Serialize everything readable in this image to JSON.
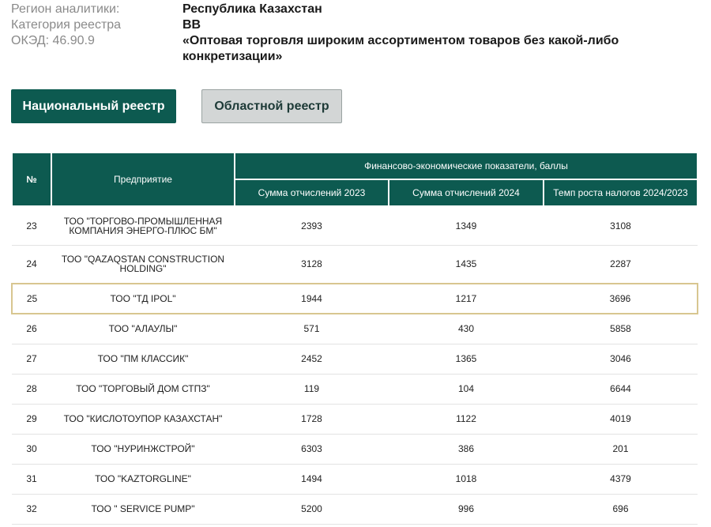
{
  "meta": {
    "region_label": "Регион аналитики:",
    "region_value": "Республика Казахстан",
    "category_label": "Категория реестра",
    "category_value": "BB",
    "okved_label": "ОКЭД: 46.90.9",
    "okved_value": "«Оптовая торговля широким ассортиментом товаров без какой-либо конкретизации»"
  },
  "buttons": {
    "national": "Национальный реестр",
    "regional": "Областной реестр"
  },
  "table": {
    "headers": {
      "num": "№",
      "enterprise": "Предприятие",
      "group": "Финансово-экономические показатели, баллы",
      "col2023": "Сумма отчислений 2023",
      "col2024": "Сумма отчислений 2024",
      "growth": "Темп роста налогов 2024/2023"
    },
    "rows": [
      {
        "num": "23",
        "name": "ТОО \"ТОРГОВО-ПРОМЫШЛЕННАЯ КОМПАНИЯ ЭНЕРГО-ПЛЮС БМ\"",
        "s2023": "2393",
        "s2024": "1349",
        "growth": "3108"
      },
      {
        "num": "24",
        "name": "ТОО \"QAZAQSTAN CONSTRUCTION HOLDING\"",
        "s2023": "3128",
        "s2024": "1435",
        "growth": "2287"
      },
      {
        "num": "25",
        "name": "ТОО \"ТД IPOL\"",
        "s2023": "1944",
        "s2024": "1217",
        "growth": "3696"
      },
      {
        "num": "26",
        "name": "ТОО \"АЛАУЛЫ\"",
        "s2023": "571",
        "s2024": "430",
        "growth": "5858"
      },
      {
        "num": "27",
        "name": "ТОО \"ПМ КЛАССИК\"",
        "s2023": "2452",
        "s2024": "1365",
        "growth": "3046"
      },
      {
        "num": "28",
        "name": "ТОО \"ТОРГОВЫЙ ДОМ СТПЗ\"",
        "s2023": "119",
        "s2024": "104",
        "growth": "6644"
      },
      {
        "num": "29",
        "name": "ТОО \"КИСЛОТОУПОР КАЗАХСТАН\"",
        "s2023": "1728",
        "s2024": "1122",
        "growth": "4019"
      },
      {
        "num": "30",
        "name": "ТОО \"НУРИНЖСТРОЙ\"",
        "s2023": "6303",
        "s2024": "386",
        "growth": "201"
      },
      {
        "num": "31",
        "name": "ТОО \"KAZTORGLINE\"",
        "s2023": "1494",
        "s2024": "1018",
        "growth": "4379"
      },
      {
        "num": "32",
        "name": "ТОО \" SERVICE PUMP\"",
        "s2023": "5200",
        "s2024": "996",
        "growth": "696"
      }
    ]
  },
  "colors": {
    "accent": "#0d5a50",
    "highlight_border": "#d8c690"
  }
}
